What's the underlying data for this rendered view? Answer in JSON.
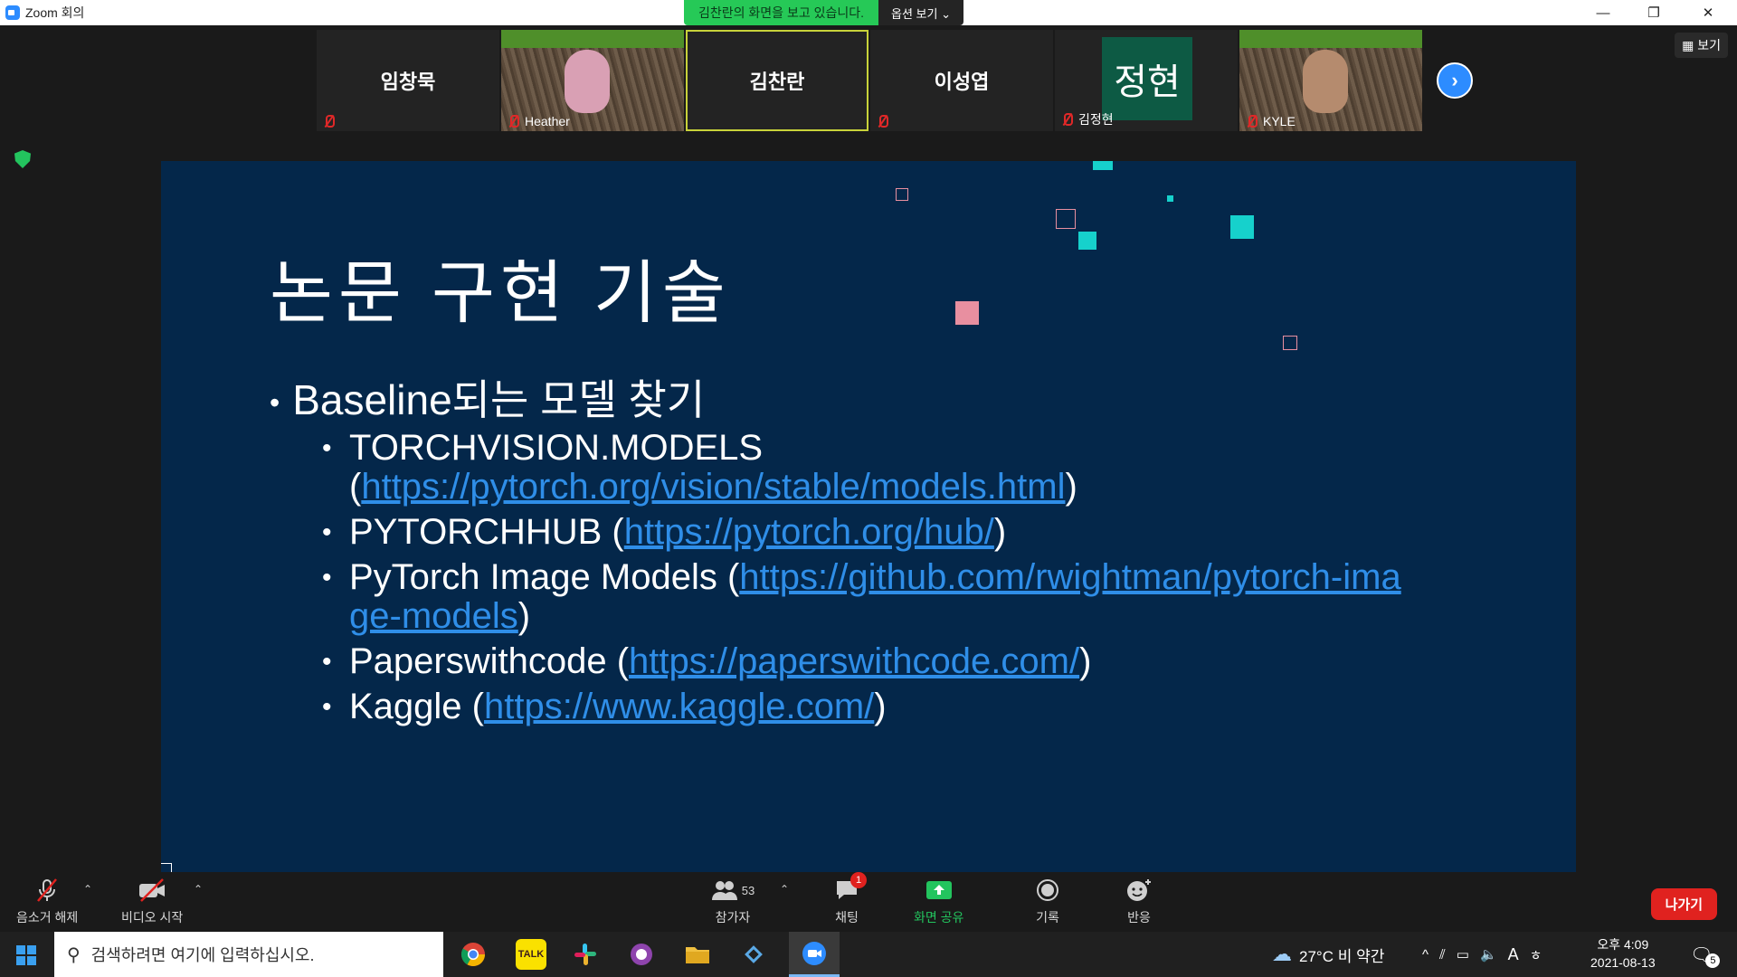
{
  "window": {
    "title": "Zoom 회의",
    "minimize": "—",
    "restore": "❐",
    "close": "✕"
  },
  "share_banner": {
    "status": "김찬란의 화면을 보고 있습니다.",
    "options_label": "옵션 보기 ⌄"
  },
  "view_button": "보기",
  "participants": [
    {
      "name": "임창묵",
      "muted": true,
      "style": "name"
    },
    {
      "name": "Heather",
      "muted": true,
      "style": "photo"
    },
    {
      "name": "김찬란",
      "muted": false,
      "style": "name",
      "active": true
    },
    {
      "name": "이성엽",
      "muted": true,
      "style": "name"
    },
    {
      "name": "김정현",
      "avatar_text": "정현",
      "muted": true,
      "style": "avatar"
    },
    {
      "name": "KYLE",
      "muted": true,
      "style": "photo"
    }
  ],
  "slide": {
    "heading": "논문 구현 기술",
    "bullet": "Baseline되는 모델 찾기",
    "items": [
      {
        "text": "TORCHVISION.MODELS",
        "open": "(",
        "link": "https://pytorch.org/vision/stable/models.html",
        "close": ")"
      },
      {
        "text": "PYTORCHHUB",
        "open": " (",
        "link": "https://pytorch.org/hub/",
        "close": ")"
      },
      {
        "text": "PyTorch Image Models",
        "open": " (",
        "link": "https://github.com/rwightman/pytorch-image-models",
        "close": ")"
      },
      {
        "text": "Paperswithcode",
        "open": " (",
        "link": "https://paperswithcode.com/",
        "close": ")"
      },
      {
        "text": "Kaggle",
        "open": " (",
        "link": "https://www.kaggle.com/",
        "close": ")"
      }
    ]
  },
  "toolbar": {
    "unmute": "음소거 해제",
    "start_video": "비디오 시작",
    "participants": "참가자",
    "participant_count": "53",
    "chat": "채팅",
    "chat_badge": "1",
    "share_screen": "화면 공유",
    "record": "기록",
    "reactions": "반응",
    "leave": "나가기"
  },
  "taskbar": {
    "search_placeholder": "검색하려면 여기에 입력하십시오.",
    "weather": "27°C  비 약간",
    "time": "오후 4:09",
    "date": "2021-08-13",
    "notification_count": "5",
    "kakao_label": "TALK",
    "ime": "A"
  },
  "colors": {
    "slide_bg": "#04274a",
    "link": "#2f8ee8",
    "accent_teal": "#16d1cc",
    "accent_pink": "#e88fa0",
    "leave_red": "#e0221f",
    "share_green": "#23c45e"
  }
}
